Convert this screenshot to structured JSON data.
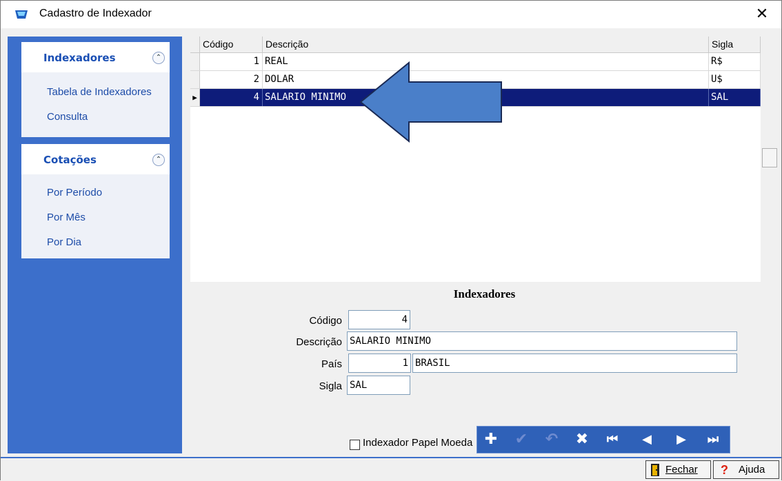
{
  "window": {
    "title": "Cadastro de Indexador",
    "close_glyph": "✕"
  },
  "sidebar": {
    "panels": [
      {
        "title": "Indexadores",
        "collapse_glyph": "≈",
        "links": [
          "Tabela de Indexadores",
          "Consulta"
        ]
      },
      {
        "title": "Cotações",
        "collapse_glyph": "≈",
        "links": [
          "Por Período",
          "Por Mês",
          "Por Dia"
        ]
      }
    ]
  },
  "grid": {
    "columns": [
      "Código",
      "Descrição",
      "Sigla"
    ],
    "rows": [
      {
        "codigo": "1",
        "descricao": "REAL",
        "sigla": "R$"
      },
      {
        "codigo": "2",
        "descricao": "DOLAR",
        "sigla": "U$"
      },
      {
        "codigo": "4",
        "descricao": "SALARIO MINIMO",
        "sigla": "SAL"
      }
    ],
    "selected_indicator": "▶"
  },
  "form": {
    "title": "Indexadores",
    "codigo_label": "Código",
    "codigo_value": "4",
    "descricao_label": "Descrição",
    "descricao_value": "SALARIO MINIMO",
    "pais_label": "País",
    "pais_code": "1",
    "pais_name": "BRASIL",
    "sigla_label": "Sigla",
    "sigla_value": "SAL",
    "checkbox_label": "Indexador Papel Moeda"
  },
  "navbar": {
    "add": "✚",
    "confirm": "✔",
    "undo": "↶",
    "delete": "✖",
    "first": "⏮",
    "prev": "◀",
    "next": "▶",
    "last": "⏭"
  },
  "statusbar": {
    "fechar": "Fechar",
    "ajuda": "Ajuda"
  },
  "colors": {
    "sidebar": "#3c6fcb",
    "selection": "#0e1c7a",
    "arrow": "#4a7fc9"
  }
}
